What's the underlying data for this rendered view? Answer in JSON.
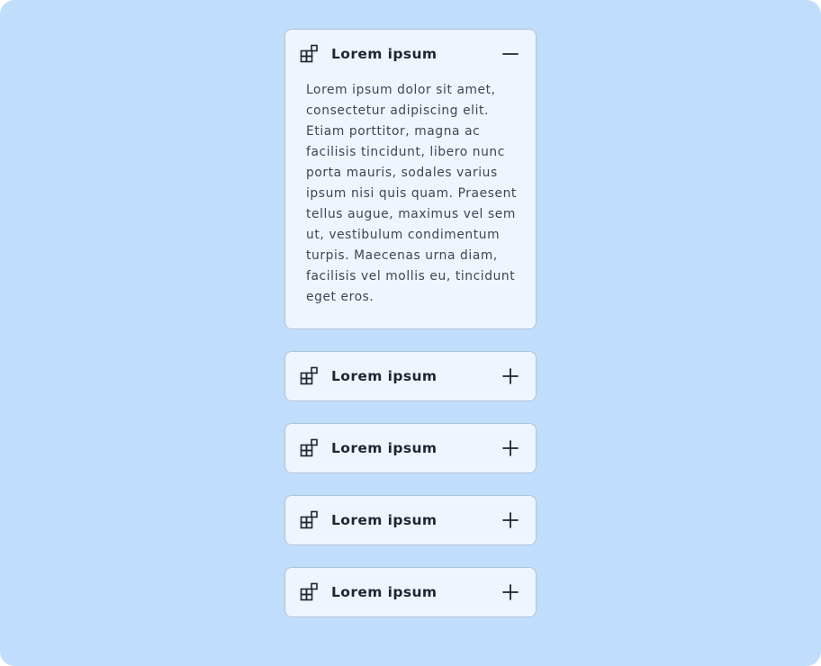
{
  "colors": {
    "background": "#c1ddfc",
    "panel": "#eef5ff",
    "border": "#aec3d9",
    "title_text": "#1f2630",
    "body_text": "#3f4651"
  },
  "accordion": {
    "items": [
      {
        "title": "Lorem ipsum",
        "icon": "blocks-icon",
        "expanded": true,
        "toggle_icon": "minus-icon",
        "content": "Lorem ipsum dolor sit amet, consectetur adipiscing elit. Etiam porttitor, magna ac facilisis tincidunt, libero nunc porta mauris, sodales varius ipsum nisi quis quam. Praesent tellus augue, maximus vel sem ut, vestibulum condimentum turpis. Maecenas urna diam, facilisis vel mollis eu, tincidunt eget eros."
      },
      {
        "title": "Lorem ipsum",
        "icon": "blocks-icon",
        "expanded": false,
        "toggle_icon": "plus-icon"
      },
      {
        "title": "Lorem ipsum",
        "icon": "blocks-icon",
        "expanded": false,
        "toggle_icon": "plus-icon"
      },
      {
        "title": "Lorem ipsum",
        "icon": "blocks-icon",
        "expanded": false,
        "toggle_icon": "plus-icon"
      },
      {
        "title": "Lorem ipsum",
        "icon": "blocks-icon",
        "expanded": false,
        "toggle_icon": "plus-icon"
      }
    ]
  }
}
